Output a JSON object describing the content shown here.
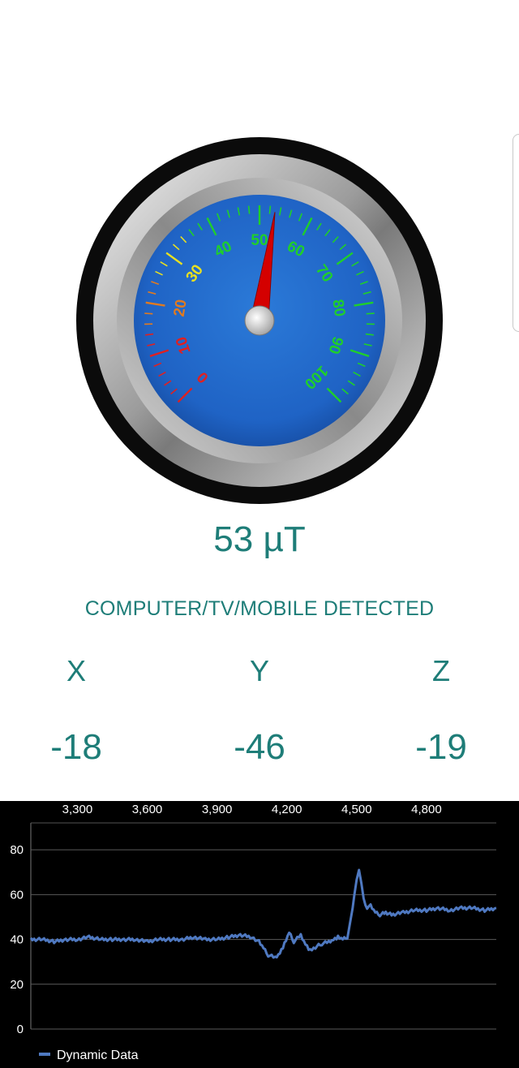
{
  "reading": {
    "value": "53 µT"
  },
  "status": {
    "text": "COMPUTER/TV/MOBILE DETECTED"
  },
  "axes": [
    {
      "label": "X",
      "value": "-18"
    },
    {
      "label": "Y",
      "value": "-46"
    },
    {
      "label": "Z",
      "value": "-19"
    }
  ],
  "gauge": {
    "min": 0,
    "max": 100,
    "needle_value": 53,
    "labels": [
      "0",
      "10",
      "20",
      "30",
      "40",
      "50",
      "60",
      "70",
      "80",
      "90",
      "100"
    ],
    "colors": {
      "outer_ring": "#0b0b0b",
      "bezel": "#a9a9a9",
      "dial": "#1f63c5",
      "needle": "#d40000",
      "low": "#e02020",
      "mid_low": "#e07a20",
      "mid": "#e8e020",
      "high": "#1fcf2a"
    }
  },
  "chart_data": {
    "type": "line",
    "title": "",
    "xlabel": "",
    "ylabel": "",
    "x_ticks": [
      3300,
      3600,
      3900,
      4200,
      4500,
      4800
    ],
    "x_tick_labels": [
      "3,300",
      "3,600",
      "3,900",
      "4,200",
      "4,500",
      "4,800"
    ],
    "y_ticks": [
      0,
      20,
      40,
      60,
      80
    ],
    "xlim": [
      3100,
      5100
    ],
    "ylim": [
      0,
      92
    ],
    "grid": true,
    "legend_position": "bottom-left",
    "series": [
      {
        "name": "Dynamic Data",
        "color": "#4f79c1",
        "x": [
          3100,
          3150,
          3200,
          3250,
          3300,
          3350,
          3400,
          3450,
          3500,
          3550,
          3600,
          3650,
          3700,
          3750,
          3800,
          3850,
          3900,
          3950,
          4000,
          4050,
          4080,
          4100,
          4120,
          4150,
          4170,
          4190,
          4210,
          4230,
          4260,
          4280,
          4300,
          4330,
          4350,
          4380,
          4400,
          4420,
          4440,
          4460,
          4475,
          4490,
          4500,
          4510,
          4520,
          4530,
          4545,
          4560,
          4580,
          4600,
          4625,
          4650,
          4700,
          4750,
          4800,
          4850,
          4900,
          4950,
          5000,
          5050,
          5100
        ],
        "y": [
          40,
          40,
          39,
          40,
          40,
          41,
          40,
          40,
          40,
          40,
          39,
          40,
          40,
          40,
          41,
          40,
          40,
          41,
          42,
          41,
          39,
          36,
          33,
          32,
          34,
          38,
          43,
          39,
          42,
          38,
          35,
          37,
          38,
          39,
          40,
          41,
          40,
          41,
          49,
          60,
          66,
          71,
          66,
          58,
          54,
          55,
          52,
          51,
          52,
          51,
          52,
          53,
          53,
          54,
          53,
          54,
          54,
          53,
          54
        ]
      }
    ]
  }
}
